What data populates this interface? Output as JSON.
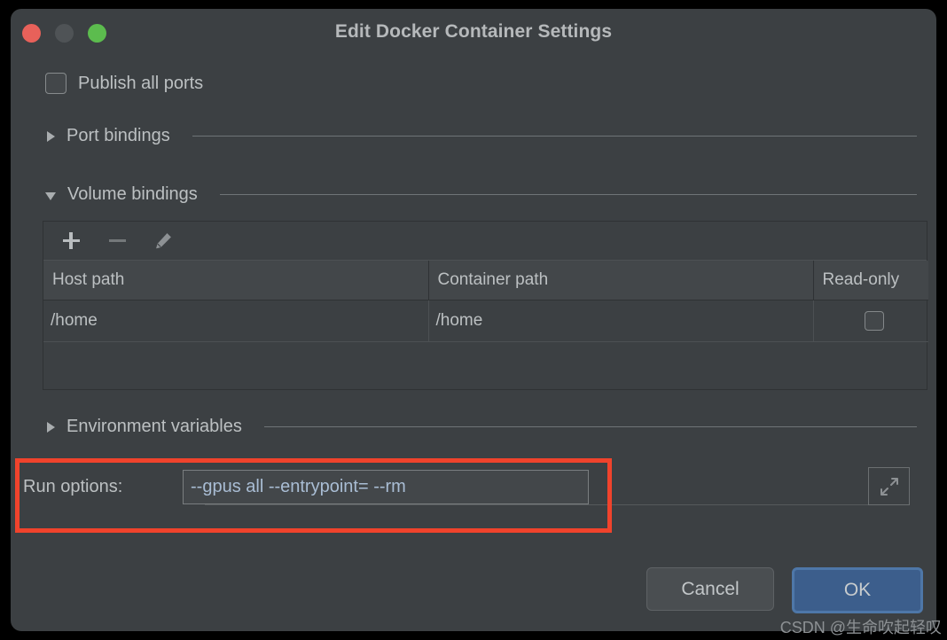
{
  "window": {
    "title": "Edit Docker Container Settings",
    "controls": {
      "close": "close-button",
      "minimize": "minimize-button",
      "maximize": "maximize-button"
    }
  },
  "form": {
    "publish_all_ports": {
      "label": "Publish all ports",
      "checked": false
    },
    "sections": [
      {
        "label": "Port bindings",
        "expanded": false
      },
      {
        "label": "Volume bindings",
        "expanded": true
      },
      {
        "label": "Environment variables",
        "expanded": false
      }
    ],
    "volume_table": {
      "toolbar": {
        "add": "add-icon",
        "remove": "remove-icon",
        "edit": "edit-icon"
      },
      "columns": [
        "Host path",
        "Container path",
        "Read-only"
      ],
      "rows": [
        {
          "host_path": "/home",
          "container_path": "/home",
          "read_only": false
        }
      ]
    },
    "run_options": {
      "label": "Run options:",
      "value": "--gpus all --entrypoint= --rm",
      "expand_icon": "expand-icon"
    }
  },
  "footer": {
    "cancel_label": "Cancel",
    "ok_label": "OK"
  },
  "watermark": "CSDN @生命吹起轻叹",
  "colors": {
    "window_background": "#3c4043",
    "text_primary": "#bcc0c2",
    "accent_blue": "#3c5e8c",
    "annotation_red": "#f0432c",
    "input_text": "#a9bdd4",
    "traffic_close": "#e8615a",
    "traffic_minimize": "#4f5356",
    "traffic_maximize": "#5cbc4e"
  }
}
